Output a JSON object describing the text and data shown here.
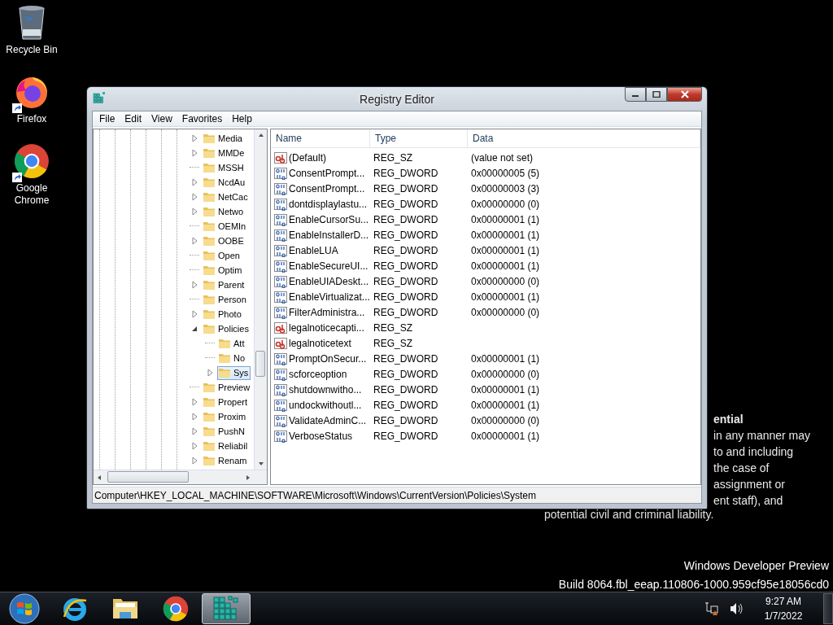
{
  "desktop_icons": [
    {
      "label": "Recycle Bin",
      "kind": "recycle-bin"
    },
    {
      "label": "Firefox",
      "kind": "firefox"
    },
    {
      "label": "Google Chrome",
      "kind": "chrome"
    }
  ],
  "background_notice": {
    "heading": "ential",
    "lines": [
      "in any manner may",
      "to and including",
      "the case of",
      "assignment or",
      "ent staff), and"
    ],
    "last_line": "potential civil and criminal liability."
  },
  "build_info": [
    "Windows Developer Preview",
    "Build 8064.fbl_eeap.110806-1000.959cf95e18056cd0"
  ],
  "window": {
    "title": "Registry Editor",
    "menu": [
      "File",
      "Edit",
      "View",
      "Favorites",
      "Help"
    ],
    "tree": [
      {
        "label": "Media",
        "expandable": true,
        "selected": false
      },
      {
        "label": "MMDe",
        "expandable": true,
        "selected": false
      },
      {
        "label": "MSSH",
        "expandable": false,
        "selected": false
      },
      {
        "label": "NcdAu",
        "expandable": true,
        "selected": false
      },
      {
        "label": "NetCac",
        "expandable": true,
        "selected": false
      },
      {
        "label": "Netwo",
        "expandable": true,
        "selected": false
      },
      {
        "label": "OEMIn",
        "expandable": false,
        "selected": false
      },
      {
        "label": "OOBE",
        "expandable": true,
        "selected": false
      },
      {
        "label": "Open",
        "expandable": false,
        "selected": false
      },
      {
        "label": "Optim",
        "expandable": false,
        "selected": false
      },
      {
        "label": "Parent",
        "expandable": true,
        "selected": false
      },
      {
        "label": "Person",
        "expandable": false,
        "selected": false
      },
      {
        "label": "Photo",
        "expandable": true,
        "selected": false
      },
      {
        "label": "Policies",
        "expandable": true,
        "selected": false,
        "children": [
          {
            "label": "Att",
            "expandable": false,
            "selected": false
          },
          {
            "label": "No",
            "expandable": false,
            "selected": false
          },
          {
            "label": "Sys",
            "expandable": true,
            "selected": true
          }
        ]
      },
      {
        "label": "Preview",
        "expandable": false,
        "selected": false
      },
      {
        "label": "Propert",
        "expandable": true,
        "selected": false
      },
      {
        "label": "Proxim",
        "expandable": true,
        "selected": false
      },
      {
        "label": "PushN",
        "expandable": true,
        "selected": false
      },
      {
        "label": "Reliabil",
        "expandable": true,
        "selected": false
      },
      {
        "label": "Renam",
        "expandable": true,
        "selected": false
      }
    ],
    "columns": [
      "Name",
      "Type",
      "Data"
    ],
    "rows": [
      {
        "kind": "string",
        "name": "(Default)",
        "type": "REG_SZ",
        "data": "(value not set)"
      },
      {
        "kind": "number",
        "name": "ConsentPrompt...",
        "type": "REG_DWORD",
        "data": "0x00000005 (5)"
      },
      {
        "kind": "number",
        "name": "ConsentPrompt...",
        "type": "REG_DWORD",
        "data": "0x00000003 (3)"
      },
      {
        "kind": "number",
        "name": "dontdisplaylastu...",
        "type": "REG_DWORD",
        "data": "0x00000000 (0)"
      },
      {
        "kind": "number",
        "name": "EnableCursorSu...",
        "type": "REG_DWORD",
        "data": "0x00000001 (1)"
      },
      {
        "kind": "number",
        "name": "EnableInstallerD...",
        "type": "REG_DWORD",
        "data": "0x00000001 (1)"
      },
      {
        "kind": "number",
        "name": "EnableLUA",
        "type": "REG_DWORD",
        "data": "0x00000001 (1)"
      },
      {
        "kind": "number",
        "name": "EnableSecureUI...",
        "type": "REG_DWORD",
        "data": "0x00000001 (1)"
      },
      {
        "kind": "number",
        "name": "EnableUIADeskt...",
        "type": "REG_DWORD",
        "data": "0x00000000 (0)"
      },
      {
        "kind": "number",
        "name": "EnableVirtualizat...",
        "type": "REG_DWORD",
        "data": "0x00000001 (1)"
      },
      {
        "kind": "number",
        "name": "FilterAdministra...",
        "type": "REG_DWORD",
        "data": "0x00000000 (0)"
      },
      {
        "kind": "string",
        "name": "legalnoticecapti...",
        "type": "REG_SZ"
      },
      {
        "kind": "string",
        "name": "legalnoticetext",
        "type": "REG_SZ"
      },
      {
        "kind": "number",
        "name": "PromptOnSecur...",
        "type": "REG_DWORD",
        "data": "0x00000001 (1)"
      },
      {
        "kind": "number",
        "name": "scforceoption",
        "type": "REG_DWORD",
        "data": "0x00000000 (0)"
      },
      {
        "kind": "number",
        "name": "shutdownwitho...",
        "type": "REG_DWORD",
        "data": "0x00000001 (1)"
      },
      {
        "kind": "number",
        "name": "undockwithoutl...",
        "type": "REG_DWORD",
        "data": "0x00000001 (1)"
      },
      {
        "kind": "number",
        "name": "ValidateAdminC...",
        "type": "REG_DWORD",
        "data": "0x00000000 (0)"
      },
      {
        "kind": "number",
        "name": "VerboseStatus",
        "type": "REG_DWORD",
        "data": "0x00000001 (1)"
      }
    ],
    "status_bar": "Computer\\HKEY_LOCAL_MACHINE\\SOFTWARE\\Microsoft\\Windows\\CurrentVersion\\Policies\\System"
  },
  "taskbar": {
    "buttons": [
      {
        "kind": "start",
        "active": false
      },
      {
        "kind": "browser-e",
        "active": false
      },
      {
        "kind": "folder",
        "active": false
      },
      {
        "kind": "chrome",
        "active": false
      },
      {
        "kind": "registry",
        "active": true
      }
    ],
    "clock": {
      "time": "9:27 AM",
      "date": "1/7/2022"
    }
  }
}
